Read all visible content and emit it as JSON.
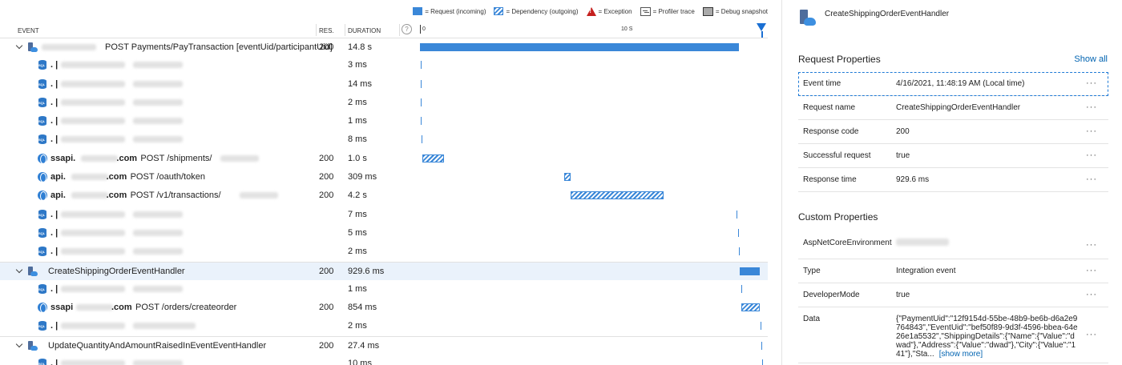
{
  "legend": {
    "request": "= Request (incoming)",
    "dependency": "= Dependency (outgoing)",
    "exception": "= Exception",
    "profiler": "= Profiler trace",
    "snapshot": "= Debug snapshot"
  },
  "header": {
    "event": "EVENT",
    "res": "RES.",
    "duration": "DURATION",
    "scale_start": "0",
    "scale_mid": "10 S",
    "help": "?"
  },
  "rows": [
    {
      "kind": "request",
      "group": true,
      "selected": false,
      "prefix": "",
      "text": "POST Payments/PayTransaction [eventUid/participantUid]",
      "res": "200",
      "duration": "14.8 s",
      "bar": "req",
      "bar_start": 0.0,
      "bar_end": 14.8
    },
    {
      "kind": "sql",
      "prefix": ". |",
      "text": "",
      "res": "",
      "duration": "3 ms",
      "bar": "thin",
      "bar_start": 0.03,
      "bar_end": 0.03
    },
    {
      "kind": "sql",
      "prefix": ". |",
      "text": "",
      "res": "",
      "duration": "14 ms",
      "bar": "thin",
      "bar_start": 0.04,
      "bar_end": 0.04
    },
    {
      "kind": "sql",
      "prefix": ". |",
      "text": "",
      "res": "",
      "duration": "2 ms",
      "bar": "thin",
      "bar_start": 0.05,
      "bar_end": 0.05
    },
    {
      "kind": "sql",
      "prefix": ". |",
      "text": "",
      "res": "",
      "duration": "1 ms",
      "bar": "thin",
      "bar_start": 0.05,
      "bar_end": 0.05
    },
    {
      "kind": "sql",
      "prefix": ". |",
      "text": "",
      "res": "",
      "duration": "8 ms",
      "bar": "thin",
      "bar_start": 0.06,
      "bar_end": 0.06
    },
    {
      "kind": "web",
      "host_a": "ssapi.",
      "host_b": ".com",
      "text": "POST /shipments/",
      "res": "200",
      "duration": "1.0 s",
      "bar": "dep",
      "bar_start": 0.1,
      "bar_end": 1.1
    },
    {
      "kind": "web",
      "host_a": "api.",
      "host_b": ".com",
      "text": "POST /oauth/token",
      "res": "200",
      "duration": "309 ms",
      "bar": "dep",
      "bar_start": 6.7,
      "bar_end": 7.0
    },
    {
      "kind": "web",
      "host_a": "api.",
      "host_b": ".com",
      "text": "POST /v1/transactions/",
      "res": "200",
      "duration": "4.2 s",
      "bar": "dep",
      "bar_start": 7.0,
      "bar_end": 11.3
    },
    {
      "kind": "sql",
      "prefix": ". |",
      "text": "",
      "res": "",
      "duration": "7 ms",
      "bar": "thin",
      "bar_start": 14.7,
      "bar_end": 14.7
    },
    {
      "kind": "sql",
      "prefix": ". |",
      "text": "",
      "res": "",
      "duration": "5 ms",
      "bar": "thin",
      "bar_start": 14.75,
      "bar_end": 14.75
    },
    {
      "kind": "sql",
      "prefix": ". |",
      "text": "",
      "res": "",
      "duration": "2 ms",
      "bar": "thin",
      "bar_start": 14.8,
      "bar_end": 14.8
    },
    {
      "kind": "request",
      "group": true,
      "selected": true,
      "prefix": "",
      "text": "CreateShippingOrderEventHandler",
      "res": "200",
      "duration": "929.6 ms",
      "bar": "req",
      "bar_start": 14.85,
      "bar_end": 15.78
    },
    {
      "kind": "sql",
      "prefix": ". |",
      "text": "",
      "res": "",
      "duration": "1 ms",
      "bar": "thin",
      "bar_start": 14.9,
      "bar_end": 14.9
    },
    {
      "kind": "web",
      "host_a": "ssapi",
      "host_b": ".com",
      "text": "POST /orders/createorder",
      "res": "200",
      "duration": "854 ms",
      "bar": "dep",
      "bar_start": 14.92,
      "bar_end": 15.77
    },
    {
      "kind": "sql",
      "prefix": ". |",
      "text": "",
      "res": "",
      "duration": "2 ms",
      "bar": "thin",
      "bar_start": 15.8,
      "bar_end": 15.8
    },
    {
      "kind": "request",
      "group": true,
      "selected": false,
      "prefix": "",
      "text": "UpdateQuantityAndAmountRaisedInEventEventHandler",
      "res": "200",
      "duration": "27.4 ms",
      "bar": "thin",
      "bar_start": 15.85,
      "bar_end": 15.85
    },
    {
      "kind": "sql",
      "prefix": ". |",
      "text": "",
      "res": "",
      "duration": "10 ms",
      "bar": "thin",
      "bar_start": 15.88,
      "bar_end": 15.88
    }
  ],
  "panel": {
    "title": "CreateShippingOrderEventHandler",
    "request_props_title": "Request Properties",
    "show_all": "Show all",
    "request_props": [
      {
        "key": "Event time",
        "value": "4/16/2021, 11:48:19 AM (Local time)"
      },
      {
        "key": "Request name",
        "value": "CreateShippingOrderEventHandler"
      },
      {
        "key": "Response code",
        "value": "200"
      },
      {
        "key": "Successful request",
        "value": "true"
      },
      {
        "key": "Response time",
        "value": "929.6 ms"
      }
    ],
    "custom_props_title": "Custom Properties",
    "custom_props": [
      {
        "key": "AspNetCoreEnvironment",
        "value": ""
      },
      {
        "key": "Type",
        "value": "Integration event"
      },
      {
        "key": "DeveloperMode",
        "value": "true"
      },
      {
        "key": "Data",
        "value": "{\"PaymentUid\":\"12f9154d-55be-48b9-be6b-d6a2e9764843\",\"EventUid\":\"bef50f89-9d3f-4596-bbea-64e26e1a5532\",\"ShippingDetails\":{\"Name\":{\"Value\":\"dwad\"},\"Address\":{\"Value\":\"dwad\"},\"City\":{\"Value\":\"141\"},\"Sta..."
      }
    ],
    "show_more": "[show more]",
    "more_label": "···"
  }
}
